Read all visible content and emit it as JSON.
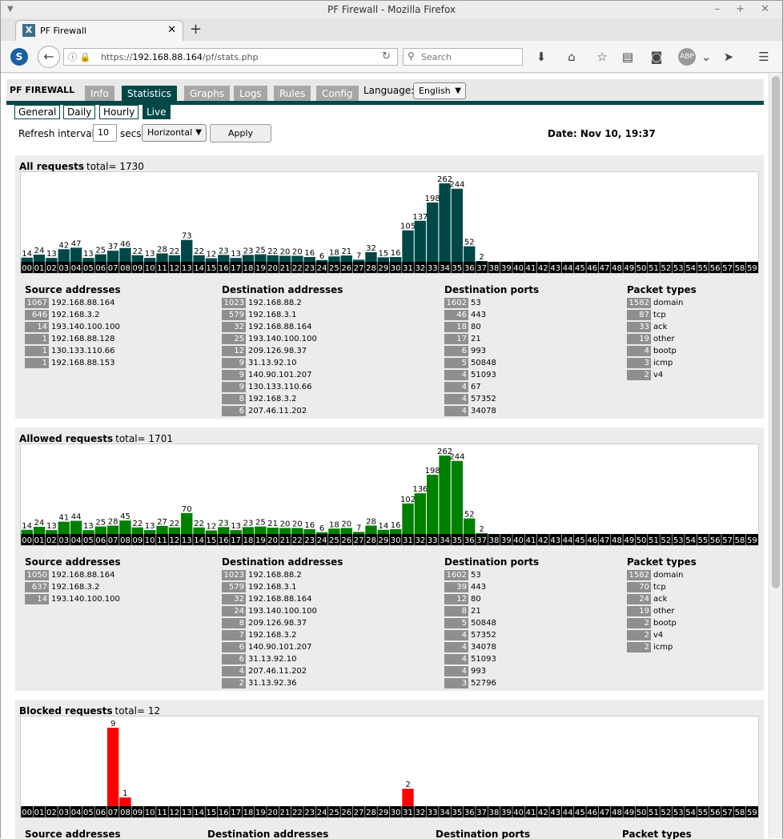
{
  "window": {
    "title": "PF Firewall - Mozilla Firefox",
    "controls": "– + ✕"
  },
  "browser": {
    "tab_title": "PF Firewall",
    "url_prefix": "https://",
    "url_host": "192.168.88.164",
    "url_path": "/pf/stats.php",
    "search_placeholder": "Search"
  },
  "app": {
    "brand": "PF FIREWALL",
    "tabs": [
      "Info",
      "Statistics",
      "Graphs",
      "Logs",
      "Rules",
      "Config"
    ],
    "active_tab": "Statistics",
    "language_label": "Language:",
    "language_value": "English",
    "subtabs": [
      "General",
      "Daily",
      "Hourly",
      "Live"
    ],
    "active_subtab": "Live",
    "refresh_label": "Refresh interval:",
    "refresh_value": "10",
    "secs_label": "secs",
    "orientation_value": "Horizontal",
    "apply_label": "Apply",
    "date_label": "Date: Nov 10, 19:37"
  },
  "sections": [
    {
      "title": "All requests",
      "total_label": "total= 1730",
      "color": "#004848",
      "columns": [
        {
          "title": "Source addresses",
          "rows": [
            [
              "1067",
              "192.168.88.164"
            ],
            [
              "646",
              "192.168.3.2"
            ],
            [
              "14",
              "193.140.100.100"
            ],
            [
              "1",
              "192.168.88.128"
            ],
            [
              "1",
              "130.133.110.66"
            ],
            [
              "1",
              "192.168.88.153"
            ]
          ]
        },
        {
          "title": "Destination addresses",
          "rows": [
            [
              "1023",
              "192.168.88.2"
            ],
            [
              "579",
              "192.168.3.1"
            ],
            [
              "32",
              "192.168.88.164"
            ],
            [
              "25",
              "193.140.100.100"
            ],
            [
              "12",
              "209.126.98.37"
            ],
            [
              "9",
              "31.13.92.10"
            ],
            [
              "9",
              "140.90.101.207"
            ],
            [
              "9",
              "130.133.110.66"
            ],
            [
              "8",
              "192.168.3.2"
            ],
            [
              "6",
              "207.46.11.202"
            ]
          ]
        },
        {
          "title": "Destination ports",
          "rows": [
            [
              "1602",
              "53"
            ],
            [
              "46",
              "443"
            ],
            [
              "18",
              "80"
            ],
            [
              "17",
              "21"
            ],
            [
              "6",
              "993"
            ],
            [
              "5",
              "50848"
            ],
            [
              "4",
              "51093"
            ],
            [
              "4",
              "67"
            ],
            [
              "4",
              "57352"
            ],
            [
              "4",
              "34078"
            ]
          ]
        },
        {
          "title": "Packet types",
          "rows": [
            [
              "1582",
              "domain"
            ],
            [
              "87",
              "tcp"
            ],
            [
              "33",
              "ack"
            ],
            [
              "19",
              "other"
            ],
            [
              "4",
              "bootp"
            ],
            [
              "3",
              "icmp"
            ],
            [
              "2",
              "v4"
            ]
          ]
        }
      ]
    },
    {
      "title": "Allowed requests",
      "total_label": "total= 1701",
      "color": "#008000",
      "columns": [
        {
          "title": "Source addresses",
          "rows": [
            [
              "1050",
              "192.168.88.164"
            ],
            [
              "637",
              "192.168.3.2"
            ],
            [
              "14",
              "193.140.100.100"
            ]
          ]
        },
        {
          "title": "Destination addresses",
          "rows": [
            [
              "1023",
              "192.168.88.2"
            ],
            [
              "579",
              "192.168.3.1"
            ],
            [
              "32",
              "192.168.88.164"
            ],
            [
              "24",
              "193.140.100.100"
            ],
            [
              "8",
              "209.126.98.37"
            ],
            [
              "7",
              "192.168.3.2"
            ],
            [
              "6",
              "140.90.101.207"
            ],
            [
              "6",
              "31.13.92.10"
            ],
            [
              "4",
              "207.46.11.202"
            ],
            [
              "2",
              "31.13.92.36"
            ]
          ]
        },
        {
          "title": "Destination ports",
          "rows": [
            [
              "1602",
              "53"
            ],
            [
              "39",
              "443"
            ],
            [
              "12",
              "80"
            ],
            [
              "8",
              "21"
            ],
            [
              "5",
              "50848"
            ],
            [
              "4",
              "57352"
            ],
            [
              "4",
              "34078"
            ],
            [
              "4",
              "51093"
            ],
            [
              "4",
              "993"
            ],
            [
              "3",
              "52796"
            ]
          ]
        },
        {
          "title": "Packet types",
          "rows": [
            [
              "1582",
              "domain"
            ],
            [
              "70",
              "tcp"
            ],
            [
              "24",
              "ack"
            ],
            [
              "19",
              "other"
            ],
            [
              "2",
              "bootp"
            ],
            [
              "2",
              "v4"
            ],
            [
              "2",
              "icmp"
            ]
          ]
        }
      ]
    },
    {
      "title": "Blocked requests",
      "total_label": "total= 12",
      "color": "#ff0000",
      "columns": [
        {
          "title": "Source addresses",
          "rows": []
        },
        {
          "title": "Destination addresses",
          "rows": []
        },
        {
          "title": "Destination ports",
          "rows": []
        },
        {
          "title": "Packet types",
          "rows": []
        }
      ]
    }
  ],
  "chart_data": [
    {
      "type": "bar",
      "categories": [
        "00",
        "01",
        "02",
        "03",
        "04",
        "05",
        "06",
        "07",
        "08",
        "09",
        "10",
        "11",
        "12",
        "13",
        "14",
        "15",
        "16",
        "17",
        "18",
        "19",
        "20",
        "21",
        "22",
        "23",
        "24",
        "25",
        "26",
        "27",
        "28",
        "29",
        "30",
        "31",
        "32",
        "33",
        "34",
        "35",
        "36",
        "37",
        "38",
        "39",
        "40",
        "41",
        "42",
        "43",
        "44",
        "45",
        "46",
        "47",
        "48",
        "49",
        "50",
        "51",
        "52",
        "53",
        "54",
        "55",
        "56",
        "57",
        "58",
        "59"
      ],
      "values": [
        14,
        24,
        13,
        42,
        47,
        13,
        25,
        37,
        46,
        22,
        13,
        28,
        22,
        73,
        22,
        12,
        23,
        13,
        23,
        25,
        22,
        20,
        20,
        16,
        6,
        18,
        21,
        7,
        32,
        15,
        16,
        105,
        137,
        198,
        262,
        244,
        52,
        2,
        null,
        null,
        null,
        null,
        null,
        null,
        null,
        null,
        null,
        null,
        null,
        null,
        null,
        null,
        null,
        null,
        null,
        null,
        null,
        null,
        null,
        null
      ],
      "title": "All requests",
      "color": "#004848"
    },
    {
      "type": "bar",
      "categories": [
        "00",
        "01",
        "02",
        "03",
        "04",
        "05",
        "06",
        "07",
        "08",
        "09",
        "10",
        "11",
        "12",
        "13",
        "14",
        "15",
        "16",
        "17",
        "18",
        "19",
        "20",
        "21",
        "22",
        "23",
        "24",
        "25",
        "26",
        "27",
        "28",
        "29",
        "30",
        "31",
        "32",
        "33",
        "34",
        "35",
        "36",
        "37",
        "38",
        "39",
        "40",
        "41",
        "42",
        "43",
        "44",
        "45",
        "46",
        "47",
        "48",
        "49",
        "50",
        "51",
        "52",
        "53",
        "54",
        "55",
        "56",
        "57",
        "58",
        "59"
      ],
      "values": [
        14,
        24,
        13,
        41,
        44,
        13,
        25,
        28,
        45,
        22,
        13,
        27,
        22,
        70,
        22,
        12,
        23,
        13,
        23,
        25,
        21,
        20,
        20,
        16,
        6,
        18,
        20,
        7,
        28,
        14,
        16,
        102,
        136,
        198,
        262,
        244,
        52,
        2,
        null,
        null,
        null,
        null,
        null,
        null,
        null,
        null,
        null,
        null,
        null,
        null,
        null,
        null,
        null,
        null,
        null,
        null,
        null,
        null,
        null,
        null
      ],
      "title": "Allowed requests",
      "color": "#008000"
    },
    {
      "type": "bar",
      "categories": [
        "00",
        "01",
        "02",
        "03",
        "04",
        "05",
        "06",
        "07",
        "08",
        "09",
        "10",
        "11",
        "12",
        "13",
        "14",
        "15",
        "16",
        "17",
        "18",
        "19",
        "20",
        "21",
        "22",
        "23",
        "24",
        "25",
        "26",
        "27",
        "28",
        "29",
        "30",
        "31",
        "32",
        "33",
        "34",
        "35",
        "36",
        "37",
        "38",
        "39",
        "40",
        "41",
        "42",
        "43",
        "44",
        "45",
        "46",
        "47",
        "48",
        "49",
        "50",
        "51",
        "52",
        "53",
        "54",
        "55",
        "56",
        "57",
        "58",
        "59"
      ],
      "values": [
        null,
        null,
        null,
        null,
        null,
        null,
        null,
        9,
        1,
        null,
        null,
        null,
        null,
        null,
        null,
        null,
        null,
        null,
        null,
        null,
        null,
        null,
        null,
        null,
        null,
        null,
        null,
        null,
        null,
        null,
        null,
        2,
        null,
        null,
        null,
        null,
        null,
        null,
        null,
        null,
        null,
        null,
        null,
        null,
        null,
        null,
        null,
        null,
        null,
        null,
        null,
        null,
        null,
        null,
        null,
        null,
        null,
        null,
        null,
        null
      ],
      "title": "Blocked requests",
      "color": "#ff0000"
    }
  ]
}
